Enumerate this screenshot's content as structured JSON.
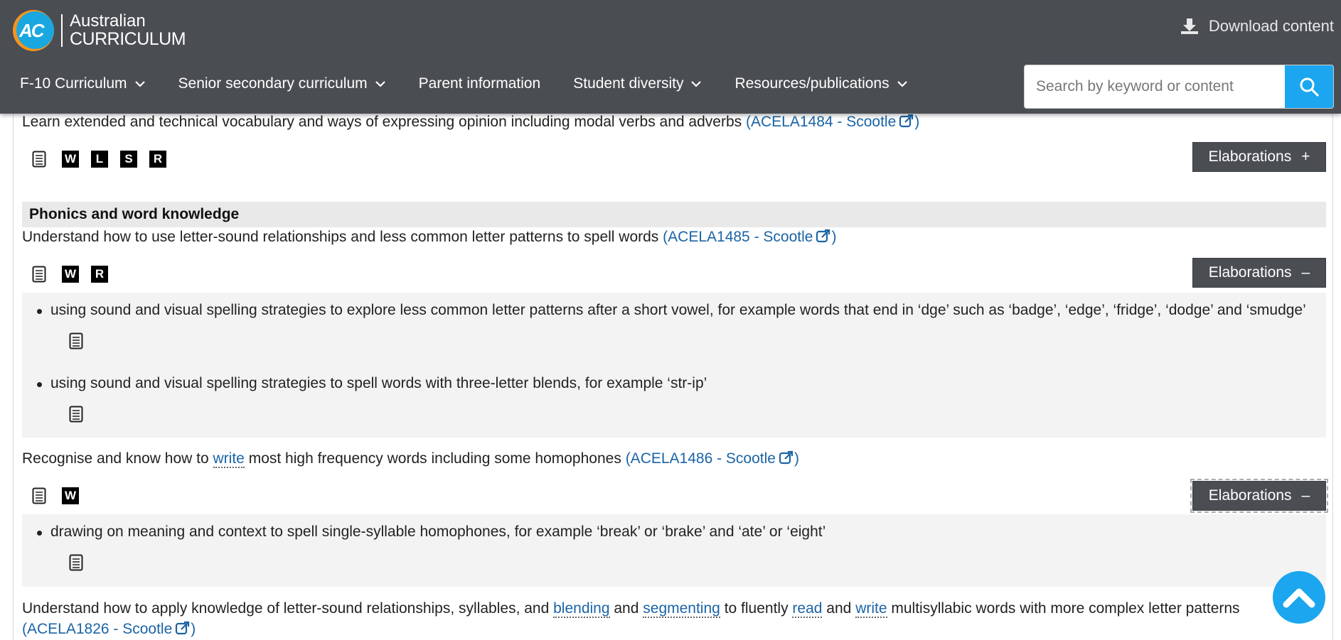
{
  "header": {
    "logo_line1": "Australian",
    "logo_line2": "CURRICULUM",
    "logo_mark": "AC",
    "download_label": "Download content",
    "nav": [
      {
        "label": "F-10 Curriculum",
        "has_menu": true
      },
      {
        "label": "Senior secondary curriculum",
        "has_menu": true
      },
      {
        "label": "Parent information",
        "has_menu": false
      },
      {
        "label": "Student diversity",
        "has_menu": true
      },
      {
        "label": "Resources/publications",
        "has_menu": true
      }
    ],
    "search": {
      "placeholder": "Search by keyword or content",
      "value": ""
    }
  },
  "content": {
    "item1": {
      "text": "Learn extended and technical vocabulary and ways of expressing opinion including modal verbs and adverbs",
      "code": "(ACELA1484 - Scootle",
      "close": ")",
      "badges": [
        "W",
        "L",
        "S",
        "R"
      ],
      "elab_label": "Elaborations",
      "elab_symbol": "+"
    },
    "section_title": "Phonics and word knowledge",
    "item2": {
      "text": "Understand how to use letter-sound relationships and less common letter patterns to spell words",
      "code": "(ACELA1485 - Scootle",
      "close": ")",
      "badges": [
        "W",
        "R"
      ],
      "elab_label": "Elaborations",
      "elab_symbol": "–",
      "elaborations": [
        "using sound and visual spelling strategies to explore less common letter patterns after a short vowel, for example words that end in ‘dge’ such as ‘badge’, ‘edge’, ‘fridge’, ‘dodge’ and ‘smudge’",
        "using sound and visual spelling strategies to spell words with three-letter blends, for example ‘str-ip’"
      ]
    },
    "item3": {
      "text_before": "Recognise and know how to",
      "term": "write",
      "text_after": "most high frequency words including some homophones",
      "code": "(ACELA1486 - Scootle",
      "close": ")",
      "badges": [
        "W"
      ],
      "elab_label": "Elaborations",
      "elab_symbol": "–",
      "elaborations": [
        "drawing on meaning and context to spell single-syllable homophones, for example ‘break’ or ‘brake’ and ‘ate’ or ‘eight’"
      ]
    },
    "item4": {
      "t1": "Understand how to apply knowledge of letter-sound relationships, syllables, and",
      "term1": "blending",
      "t2": "and",
      "term2": "segmenting",
      "t3": "to fluently",
      "term3": "read",
      "t4": "and",
      "term4": "write",
      "t5": "multisyllabic words with more complex letter patterns",
      "code": "(ACELA1826 - Scootle",
      "close": ")"
    }
  }
}
